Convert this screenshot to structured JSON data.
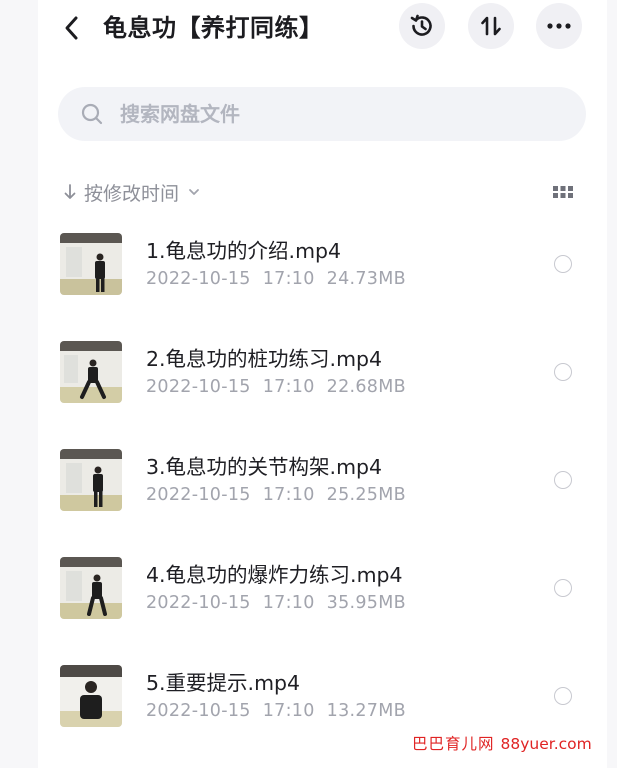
{
  "header": {
    "title": "龟息功【养打同练】",
    "back_icon": "chevron-left-icon",
    "history_icon": "history-icon",
    "sort_toggle_icon": "sort-arrows-icon",
    "more_icon": "more-dots-icon"
  },
  "search": {
    "placeholder": "搜索网盘文件",
    "value": ""
  },
  "sort": {
    "label": "按修改时间",
    "direction_icon": "arrow-down-icon",
    "dropdown_icon": "chevron-down-icon",
    "view_toggle_icon": "grid-view-icon"
  },
  "files": [
    {
      "name": "1.龟息功的介绍.mp4",
      "date": "2022-10-15",
      "time": "17:10",
      "size": "24.73MB"
    },
    {
      "name": "2.龟息功的桩功练习.mp4",
      "date": "2022-10-15",
      "time": "17:10",
      "size": "22.68MB"
    },
    {
      "name": "3.龟息功的关节构架.mp4",
      "date": "2022-10-15",
      "time": "17:10",
      "size": "25.25MB"
    },
    {
      "name": "4.龟息功的爆炸力练习.mp4",
      "date": "2022-10-15",
      "time": "17:10",
      "size": "35.95MB"
    },
    {
      "name": "5.重要提示.mp4",
      "date": "2022-10-15",
      "time": "17:10",
      "size": "13.27MB"
    }
  ],
  "watermark": {
    "cn": "巴巴育儿网",
    "en": "88yuer.com"
  },
  "colors": {
    "accent_bg": "#f0f0f4",
    "watermark": "#e02424",
    "muted_text": "#a2a4ad"
  }
}
